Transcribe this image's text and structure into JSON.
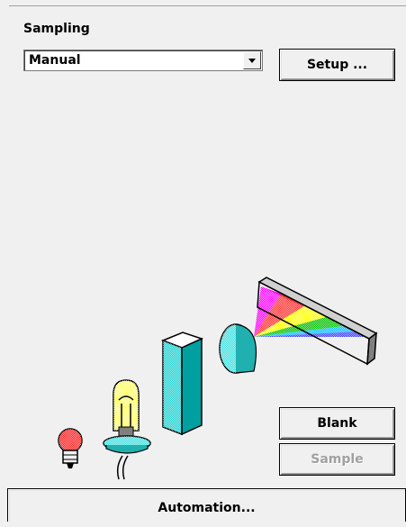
{
  "sampling": {
    "label": "Sampling",
    "selected_mode": "Manual"
  },
  "buttons": {
    "setup": "Setup ...",
    "blank": "Blank",
    "sample": "Sample",
    "automation": "Automation..."
  },
  "illustration": {
    "icons": [
      "lamp-icon",
      "bulb-icon",
      "cuvette-icon",
      "lens-icon",
      "diffraction-grating-icon"
    ],
    "spectrum_colors": [
      "#ff00ff",
      "#ff0000",
      "#ffff00",
      "#00c000",
      "#00c0ff",
      "#4040ff"
    ]
  },
  "colors": {
    "background": "#f0f0f0",
    "disabled_text": "#a0a0a0"
  }
}
